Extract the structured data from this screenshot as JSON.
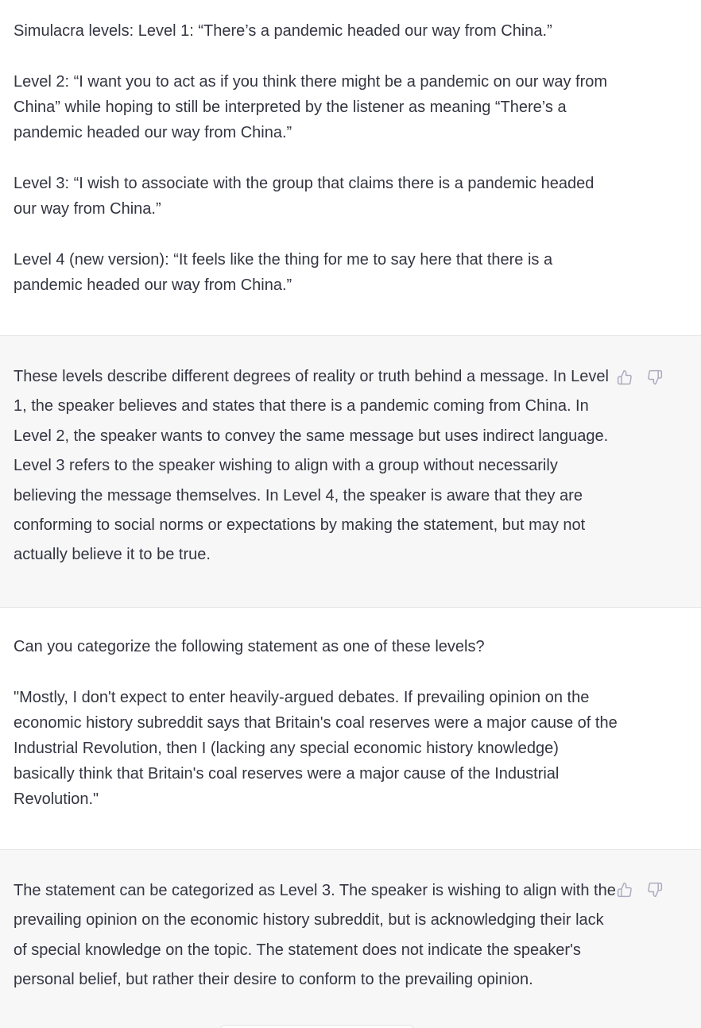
{
  "messages": [
    {
      "role": "user",
      "paragraphs": [
        "Simulacra levels: Level 1: “There’s a pandemic headed our way from China.”",
        "Level 2: “I want you to act as if you think there might be a pandemic on our way from China” while hoping to still be interpreted by the listener as meaning “There’s a pandemic headed our way from China.”",
        "Level 3: “I wish to associate with the group that claims there is a pandemic headed our way from China.”",
        "Level 4 (new version): “It feels like the thing for me to say here that there is a pandemic headed our way from China.”"
      ]
    },
    {
      "role": "assistant",
      "paragraphs": [
        "These levels describe different degrees of reality or truth behind a message. In Level 1, the speaker believes and states that there is a pandemic coming from China. In Level 2, the speaker wants to convey the same message but uses indirect language. Level 3 refers to the speaker wishing to align with a group without necessarily believing the message themselves. In Level 4, the speaker is aware that they are conforming to social norms or expectations by making the statement, but may not actually believe it to be true."
      ]
    },
    {
      "role": "user",
      "paragraphs": [
        "Can you categorize the following statement as one of these levels?",
        "\"Mostly, I don't expect to enter heavily-argued debates. If prevailing opinion on the economic history subreddit says that Britain's coal reserves were a major cause of the Industrial Revolution, then I (lacking any special economic history knowledge) basically think that Britain's coal reserves were a major cause of the Industrial Revolution.\""
      ]
    },
    {
      "role": "assistant",
      "paragraphs": [
        "The statement can be categorized as Level 3. The speaker is wishing to align with the prevailing opinion on the economic history subreddit, but is acknowledging their lack of special knowledge on the topic. The statement does not indicate the speaker's personal belief, but rather their desire to conform to the prevailing opinion."
      ]
    }
  ],
  "icons": {
    "thumbs_up": "thumbs-up-icon",
    "thumbs_down": "thumbs-down-icon"
  },
  "colors": {
    "text": "#343541",
    "assistant_bg": "#f7f7f8",
    "user_bg": "#ffffff",
    "icon": "#acacbe",
    "divider": "#e5e5e6"
  }
}
